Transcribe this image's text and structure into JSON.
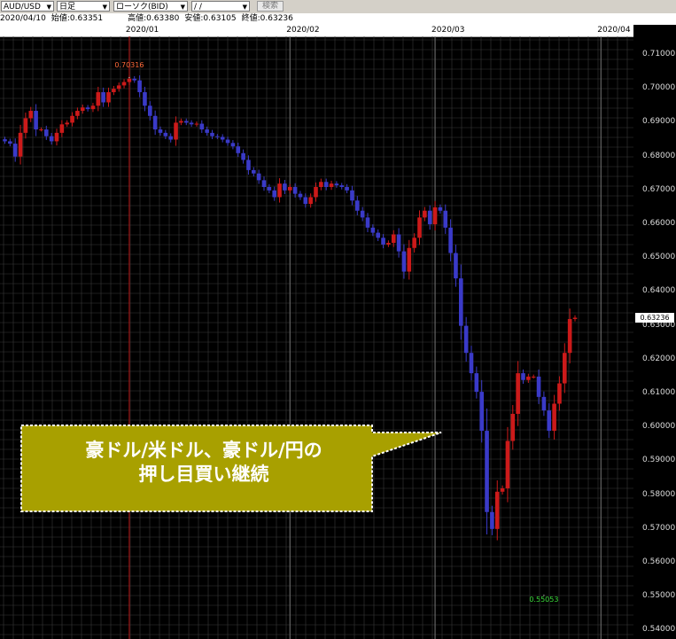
{
  "toolbar": {
    "symbol": "AUD/USD",
    "period": "日足",
    "chart_kind": "ローソク(BID)",
    "date_input": " /  /",
    "search_label": "検索"
  },
  "info": {
    "date": "2020/04/10",
    "open": "始値:0.63351",
    "high": "高値:0.63380",
    "low": "安値:0.63105",
    "close": "終値:0.63236"
  },
  "callout": {
    "line1": "豪ドル/米ドル、豪ドル/円の",
    "line2": "押し目買い継続"
  },
  "colors": {
    "up": "#cc1a1a",
    "down": "#3a3ac8",
    "callout_bg": "#a8a000",
    "grid": "#3a3a3a"
  },
  "chart_data": {
    "type": "candlestick",
    "title": "",
    "xlabel": "",
    "ylabel": "",
    "ylim": [
      0.5375,
      0.7155
    ],
    "yticks": [
      "0.71000",
      "0.70000",
      "0.69000",
      "0.68000",
      "0.67000",
      "0.66000",
      "0.65000",
      "0.64000",
      "0.63000",
      "0.62000",
      "0.61000",
      "0.60000",
      "0.59000",
      "0.58000",
      "0.57000",
      "0.56000",
      "0.55000",
      "0.54000"
    ],
    "month_labels": [
      {
        "label": "2020/01",
        "index": 24
      },
      {
        "label": "2020/02",
        "index": 55
      },
      {
        "label": "2020/03",
        "index": 83
      },
      {
        "label": "2020/04",
        "index": 115
      }
    ],
    "annotations": [
      {
        "label": "0.70316",
        "value": 0.70316,
        "index": 24,
        "pos": "above"
      },
      {
        "label": "0.55053",
        "value": 0.55053,
        "index": 104,
        "pos": "below"
      }
    ],
    "last_price": "0.63236",
    "last_value": 0.63236,
    "close": [
      0.6845,
      0.6838,
      0.68,
      0.687,
      0.6913,
      0.6935,
      0.688,
      0.688,
      0.686,
      0.6845,
      0.687,
      0.6895,
      0.69,
      0.692,
      0.6935,
      0.6945,
      0.694,
      0.695,
      0.699,
      0.696,
      0.699,
      0.7,
      0.701,
      0.702,
      0.703,
      0.7025,
      0.699,
      0.695,
      0.692,
      0.688,
      0.687,
      0.686,
      0.685,
      0.69,
      0.6905,
      0.69,
      0.6895,
      0.6897,
      0.688,
      0.687,
      0.686,
      0.6858,
      0.685,
      0.684,
      0.683,
      0.681,
      0.679,
      0.676,
      0.675,
      0.673,
      0.671,
      0.67,
      0.668,
      0.672,
      0.67,
      0.671,
      0.669,
      0.668,
      0.666,
      0.668,
      0.671,
      0.6725,
      0.671,
      0.672,
      0.6715,
      0.671,
      0.67,
      0.667,
      0.664,
      0.662,
      0.659,
      0.6575,
      0.656,
      0.654,
      0.6545,
      0.657,
      0.652,
      0.646,
      0.653,
      0.656,
      0.662,
      0.664,
      0.66,
      0.665,
      0.664,
      0.659,
      0.6515,
      0.644,
      0.63,
      0.622,
      0.616,
      0.6105,
      0.599,
      0.575,
      0.57,
      0.581,
      0.582,
      0.596,
      0.604,
      0.616,
      0.614,
      0.615,
      0.615,
      0.609,
      0.605,
      0.599,
      0.607,
      0.613,
      0.622,
      0.632,
      0.6324
    ]
  }
}
